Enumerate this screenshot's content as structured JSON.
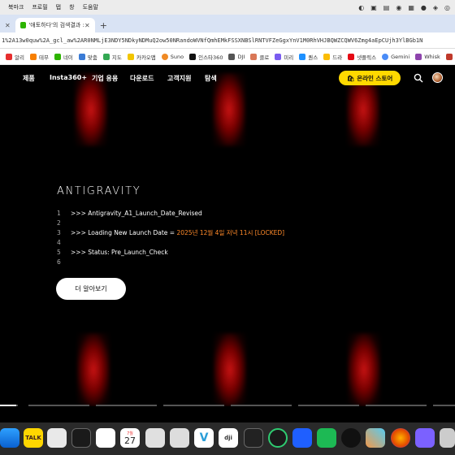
{
  "menubar": {
    "items": [
      "북마크",
      "프로필",
      "탭",
      "창",
      "도움말"
    ]
  },
  "browser": {
    "active_tab_title": "'애토하다'의 검색결과 : 네이버 쇼",
    "url": "1%2A13w0quw%2A_gcl_aw%2AR0NMLjE3NDY5NDkyNDMuQ2ow50NRandoWVNfQmhEMkFSSXNBSlRNTVFZeGgxYnV1M0RhVHJBQWZCQWV6Zmg4aEpCUjh3YlBGb1N",
    "bookmarks": [
      "알리",
      "테무",
      "네이",
      "맞춤",
      "지도",
      "카카오맵",
      "Suno",
      "인스타360",
      "DJI",
      "클로",
      "미리",
      "퀀스",
      "드라",
      "넷플릭스",
      "Gemini",
      "Whisk",
      "AI"
    ]
  },
  "site": {
    "nav": [
      "제품",
      "Insta360+",
      "기업 응용",
      "다운로드",
      "고객지원",
      "탐색"
    ],
    "store_label": "온라인 스토어",
    "logo_text": "ANTIGRAVITY",
    "code_lines": [
      {
        "num": "1",
        "text": ">>> Antigravity_A1_Launch_Date_Revised",
        "hl": ""
      },
      {
        "num": "2",
        "text": "",
        "hl": ""
      },
      {
        "num": "3",
        "text": ">>> Loading New Launch Date = ",
        "hl": "2025년 12월 4일 저녁 11시 [LOCKED]"
      },
      {
        "num": "4",
        "text": "",
        "hl": ""
      },
      {
        "num": "5",
        "text": ">>> Status: Pre_Launch_Check",
        "hl": ""
      },
      {
        "num": "6",
        "text": "",
        "hl": ""
      }
    ],
    "more_label": "더 알아보기"
  },
  "dock": {
    "calendar_month": "7월",
    "calendar_day": "27"
  },
  "colors": {
    "accent_yellow": "#ffd900",
    "highlight_orange": "#ff8a2a",
    "glow_red": "#c81414"
  }
}
